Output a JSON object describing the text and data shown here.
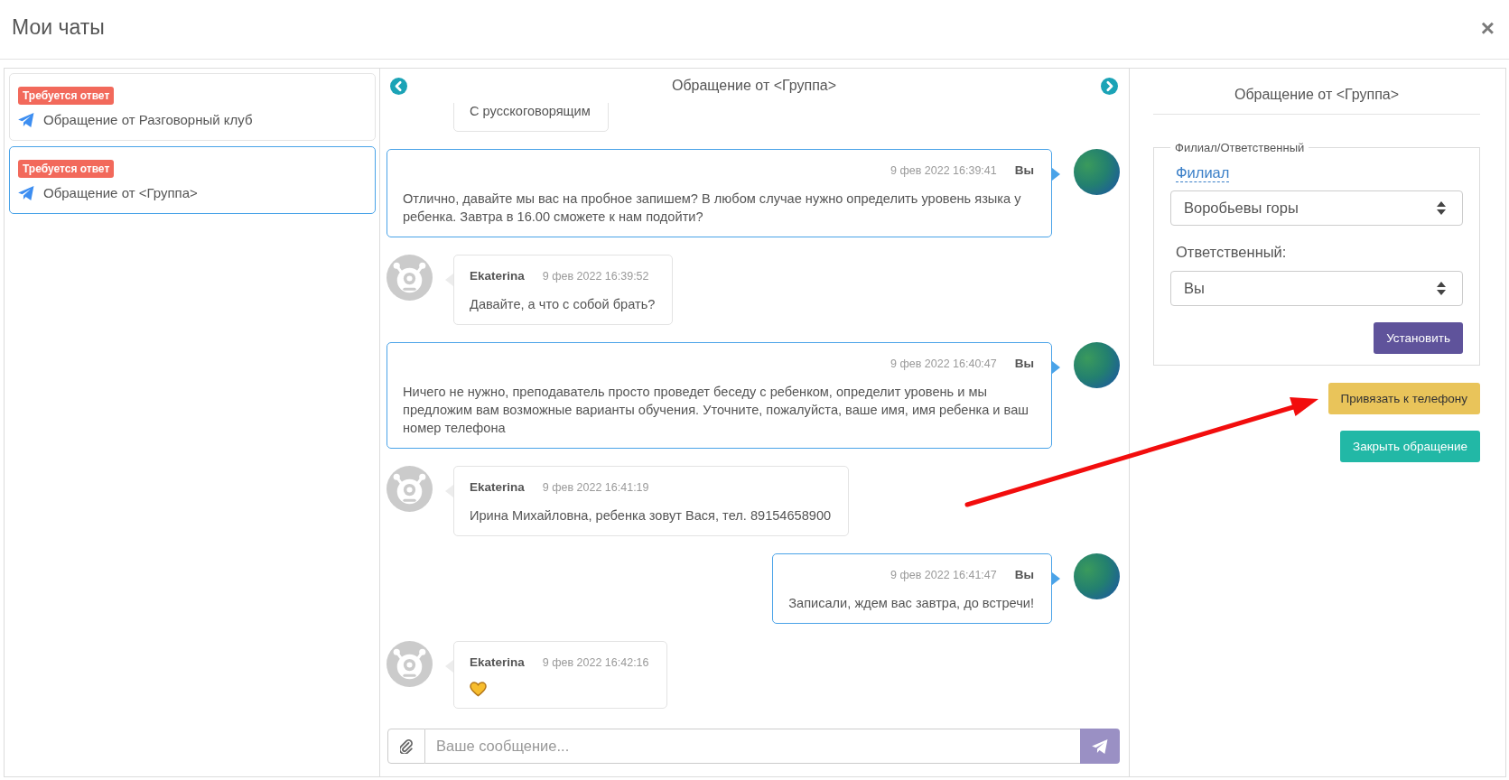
{
  "window": {
    "title": "Мои чаты",
    "close": "×"
  },
  "chats": [
    {
      "badge": "Требуется ответ",
      "title": "Обращение от Разговорный клуб",
      "selected": false
    },
    {
      "badge": "Требуется ответ",
      "title": "Обращение от <Группа>",
      "selected": true
    }
  ],
  "conversation": {
    "title": "Обращение от <Группа>",
    "messages": [
      {
        "kind": "received",
        "text": "С русскоговорящим"
      },
      {
        "kind": "sent",
        "author": "Вы",
        "time": "9 фев 2022 16:39:41",
        "text": "Отлично, давайте мы вас на пробное запишем? В любом случае нужно определить уровень языка у ребенка. Завтра в 16.00 сможете к нам подойти?"
      },
      {
        "kind": "received",
        "author": "Ekaterina",
        "time": "9 фев 2022 16:39:52",
        "text": "Давайте, а что с собой брать?"
      },
      {
        "kind": "sent",
        "author": "Вы",
        "time": "9 фев 2022 16:40:47",
        "text": "Ничего не нужно, преподаватель просто проведет беседу с ребенком, определит уровень и мы предложим вам возможные варианты обучения. Уточните, пожалуйста, ваше имя, имя ребенка и ваш номер телефона"
      },
      {
        "kind": "received",
        "author": "Ekaterina",
        "time": "9 фев 2022 16:41:19",
        "text": "Ирина Михайловна, ребенка зовут Вася, тел. 89154658900"
      },
      {
        "kind": "sent",
        "author": "Вы",
        "time": "9 фев 2022 16:41:47",
        "text": "Записали, ждем вас завтра, до встречи!"
      },
      {
        "kind": "emoji",
        "author": "Ekaterina",
        "time": "9 фев 2022 16:42:16"
      }
    ],
    "composer": {
      "placeholder": "Ваше сообщение..."
    }
  },
  "details": {
    "title": "Обращение от <Группа>",
    "fieldset": {
      "legend": "Филиал/Ответственный",
      "branch_label": "Филиал",
      "branch": "Воробьевы горы",
      "owner_label": "Ответственный:",
      "owner": "Вы",
      "apply": "Установить"
    },
    "buttons": [
      {
        "kind": "warning",
        "label": "Привязать к телефону"
      },
      {
        "kind": "success",
        "label": "Закрыть обращение"
      }
    ]
  }
}
